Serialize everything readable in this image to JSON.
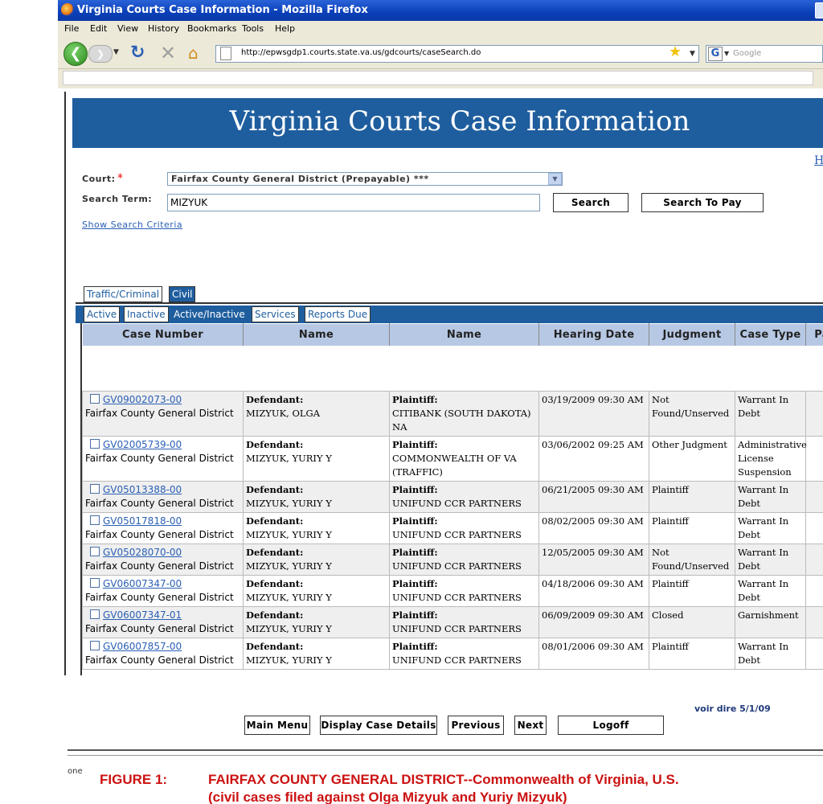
{
  "browser": {
    "window_title": "Virginia Courts Case Information - Mozilla Firefox",
    "menu": [
      "File",
      "Edit",
      "View",
      "History",
      "Bookmarks",
      "Tools",
      "Help"
    ],
    "url": "http://epwsgdp1.courts.state.va.us/gdcourts/caseSearch.do",
    "search_placeholder": "Google",
    "icons": [
      "firefox-logo",
      "back-icon",
      "forward-icon",
      "reload-icon",
      "stop-icon",
      "home-icon",
      "page-icon",
      "star-icon",
      "google-icon"
    ]
  },
  "page": {
    "title": "Virginia Courts Case Information",
    "help_link": "H",
    "court_label": "Court:",
    "required_mark": "*",
    "court_value": "Fairfax County General District (Prepayable) ***",
    "search_term_label": "Search Term:",
    "search_term_value": "MIZYUK",
    "search_button": "Search",
    "search_to_pay_button": "Search To Pay",
    "show_criteria_link": "Show Search Criteria",
    "accent_color": "#1f5e9e"
  },
  "tabs": {
    "main": [
      {
        "label": "Traffic/Criminal",
        "active": false
      },
      {
        "label": "Civil",
        "active": true
      }
    ],
    "sub": [
      {
        "label": "Active",
        "active": false
      },
      {
        "label": "Inactive",
        "active": false
      },
      {
        "label": "Active/Inactive",
        "active": true
      },
      {
        "label": "Services",
        "active": false
      },
      {
        "label": "Reports Due",
        "active": false
      }
    ]
  },
  "table": {
    "headers": [
      "Case Number",
      "Name",
      "Name",
      "Hearing Date",
      "Judgment",
      "Case Type",
      "Pa"
    ],
    "rows": [
      {
        "case_number": "GV09002073-00",
        "court": "Fairfax County General District",
        "def_label": "Defendant:",
        "defendant": "MIZYUK, OLGA",
        "pl_label": "Plaintiff:",
        "plaintiff": "CITIBANK (SOUTH DAKOTA) NA",
        "hearing_date": "03/19/2009 09:30 AM",
        "judgment": "Not Found/Unserved",
        "case_type": "Warrant In Debt"
      },
      {
        "case_number": "GV02005739-00",
        "court": "Fairfax County General District",
        "def_label": "Defendant:",
        "defendant": "MIZYUK, YURIY Y",
        "pl_label": "Plaintiff:",
        "plaintiff": "COMMONWEALTH OF VA (TRAFFIC)",
        "hearing_date": "03/06/2002 09:25 AM",
        "judgment": "Other Judgment",
        "case_type": "Administrative License Suspension"
      },
      {
        "case_number": "GV05013388-00",
        "court": "Fairfax County General District",
        "def_label": "Defendant:",
        "defendant": "MIZYUK, YURIY Y",
        "pl_label": "Plaintiff:",
        "plaintiff": "UNIFUND CCR PARTNERS",
        "hearing_date": "06/21/2005 09:30 AM",
        "judgment": "Plaintiff",
        "case_type": "Warrant In Debt"
      },
      {
        "case_number": "GV05017818-00",
        "court": "Fairfax County General District",
        "def_label": "Defendant:",
        "defendant": "MIZYUK, YURIY Y",
        "pl_label": "Plaintiff:",
        "plaintiff": "UNIFUND CCR PARTNERS",
        "hearing_date": "08/02/2005 09:30 AM",
        "judgment": "Plaintiff",
        "case_type": "Warrant In Debt"
      },
      {
        "case_number": "GV05028070-00",
        "court": "Fairfax County General District",
        "def_label": "Defendant:",
        "defendant": "MIZYUK, YURIY Y",
        "pl_label": "Plaintiff:",
        "plaintiff": "UNIFUND CCR PARTNERS",
        "hearing_date": "12/05/2005 09:30 AM",
        "judgment": "Not Found/Unserved",
        "case_type": "Warrant In Debt"
      },
      {
        "case_number": "GV06007347-00",
        "court": "Fairfax County General District",
        "def_label": "Defendant:",
        "defendant": "MIZYUK, YURIY Y",
        "pl_label": "Plaintiff:",
        "plaintiff": "UNIFUND CCR PARTNERS",
        "hearing_date": "04/18/2006 09:30 AM",
        "judgment": "Plaintiff",
        "case_type": "Warrant In Debt"
      },
      {
        "case_number": "GV06007347-01",
        "court": "Fairfax County General District",
        "def_label": "Defendant:",
        "defendant": "MIZYUK, YURIY Y",
        "pl_label": "Plaintiff:",
        "plaintiff": "UNIFUND CCR PARTNERS",
        "hearing_date": "06/09/2009 09:30 AM",
        "judgment": "Closed",
        "case_type": "Garnishment"
      },
      {
        "case_number": "GV06007857-00",
        "court": "Fairfax County General District",
        "def_label": "Defendant:",
        "defendant": "MIZYUK, YURIY Y",
        "pl_label": "Plaintiff:",
        "plaintiff": "UNIFUND CCR PARTNERS",
        "hearing_date": "08/01/2006 09:30 AM",
        "judgment": "Plaintiff",
        "case_type": "Warrant In Debt"
      }
    ]
  },
  "footer_buttons": [
    "Main Menu",
    "Display Case Details",
    "Previous",
    "Next",
    "Logoff"
  ],
  "annotation": "voir dire 5/1/09",
  "status_text": "one",
  "figure": {
    "label": "FIGURE 1:",
    "title": "FAIRFAX COUNTY GENERAL DISTRICT--Commonwealth of Virginia, U.S.",
    "subtitle": "(civil cases filed against Olga Mizyuk and Yuriy Mizyuk)",
    "color": "#cc1111"
  }
}
